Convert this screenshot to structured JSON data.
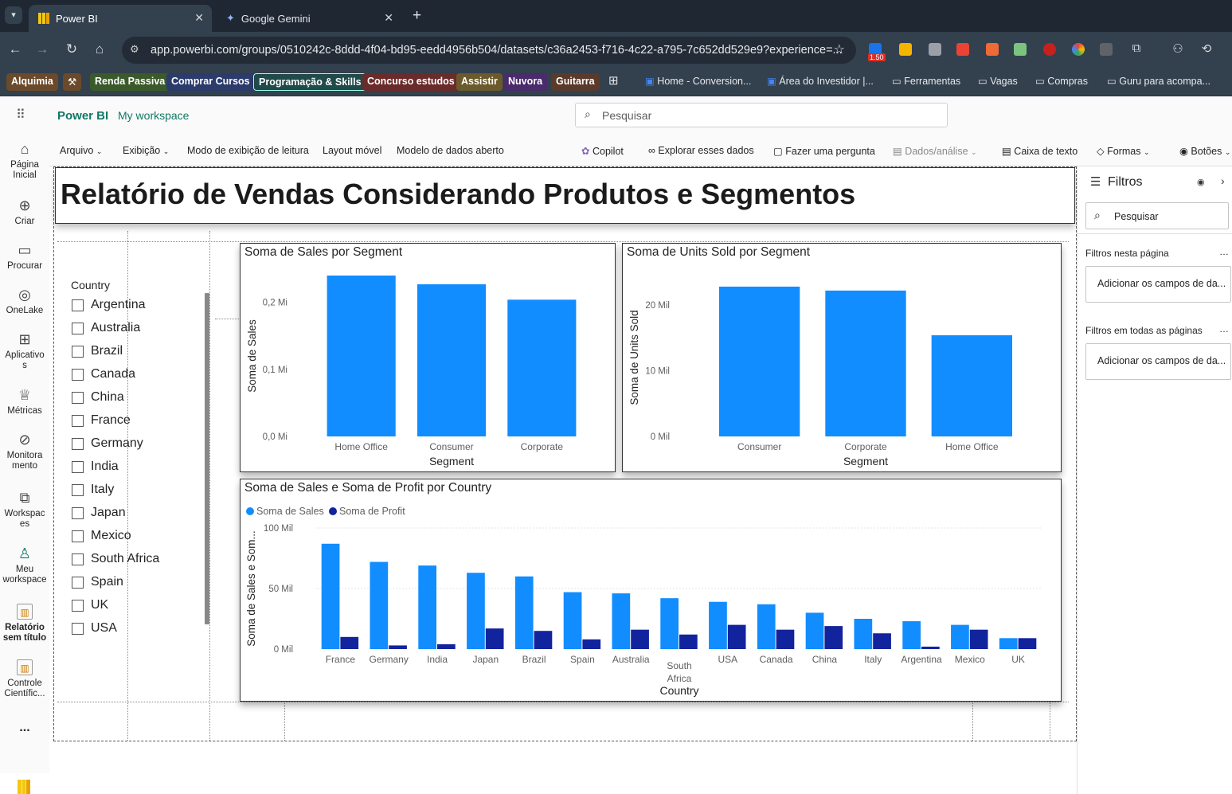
{
  "browser": {
    "tabs": [
      {
        "label": "Power BI"
      },
      {
        "label": "Google Gemini"
      }
    ],
    "url": "app.powerbi.com/groups/0510242c-8ddd-4f04-bd95-eedd4956b504/datasets/c36a2453-f716-4c22-a795-7c652dd529e9?experience=...",
    "ext_badge": "1.50",
    "bookmarks": [
      "Alquimia",
      "Renda Passiva",
      "Comprar Cursos",
      "Programação & Skills",
      "Concurso estudos",
      "Assistir",
      "Nuvora",
      "Guitarra"
    ],
    "bookmark_folders": [
      "Home - Conversion...",
      "Área do Investidor |...",
      "Ferramentas",
      "Vagas",
      "Compras",
      "Guru para acompa..."
    ]
  },
  "header": {
    "brand": "Power BI",
    "workspace": "My workspace",
    "search_placeholder": "Pesquisar"
  },
  "ribbon": {
    "arquivo": "Arquivo",
    "exibicao": "Exibição",
    "leitura": "Modo de exibição de leitura",
    "layout": "Layout móvel",
    "modelo": "Modelo de dados aberto",
    "copilot": "Copilot",
    "explorar": "Explorar esses dados",
    "pergunta": "Fazer uma pergunta",
    "dados": "Dados/análise",
    "caixa": "Caixa de texto",
    "formas": "Formas",
    "botoes": "Botões"
  },
  "leftnav": {
    "home": [
      "Página",
      "Inicial"
    ],
    "criar": "Criar",
    "procurar": "Procurar",
    "onelake": "OneLake",
    "aplicativos": [
      "Aplicativo",
      "s"
    ],
    "metricas": "Métricas",
    "monitoramento": [
      "Monitora",
      "mento"
    ],
    "workspaces": [
      "Workspac",
      "es"
    ],
    "meu": [
      "Meu",
      "workspace"
    ],
    "relatorio": [
      "Relatório",
      "sem título"
    ],
    "controle": [
      "Controle",
      "Científic..."
    ],
    "more": "..."
  },
  "report": {
    "title": "Relatório de Vendas Considerando Produtos e Segmentos"
  },
  "slicer": {
    "header": "Country",
    "items": [
      "Argentina",
      "Australia",
      "Brazil",
      "Canada",
      "China",
      "France",
      "Germany",
      "India",
      "Italy",
      "Japan",
      "Mexico",
      "South Africa",
      "Spain",
      "UK",
      "USA"
    ]
  },
  "filters": {
    "title": "Filtros",
    "search_placeholder": "Pesquisar",
    "this_page": "Filtros nesta página",
    "this_page_card": "Adicionar os campos de da...",
    "all_pages": "Filtros em todas as páginas",
    "all_pages_card": "Adicionar os campos de da..."
  },
  "chart_data": [
    {
      "type": "bar",
      "title": "Soma de Sales por Segment",
      "xlabel": "Segment",
      "ylabel": "Soma de Sales",
      "categories": [
        "Home Office",
        "Consumer",
        "Corporate"
      ],
      "values": [
        0.24,
        0.227,
        0.204
      ],
      "ylim": [
        0,
        0.24
      ],
      "yticks": [
        0,
        0.1,
        0.2
      ],
      "ytick_labels": [
        "0,0 Mi",
        "0,1 Mi",
        "0,2 Mi"
      ],
      "color": "#118DFF"
    },
    {
      "type": "bar",
      "title": "Soma de Units Sold por Segment",
      "xlabel": "Segment",
      "ylabel": "Soma de Units Sold",
      "categories": [
        "Consumer",
        "Corporate",
        "Home Office"
      ],
      "values": [
        22.8,
        22.2,
        15.4
      ],
      "ylim": [
        0,
        24
      ],
      "yticks": [
        0,
        10,
        20
      ],
      "ytick_labels": [
        "0 Mil",
        "10 Mil",
        "20 Mil"
      ],
      "color": "#118DFF"
    },
    {
      "type": "bar",
      "title": "Soma de Sales e Soma de Profit por Country",
      "xlabel": "Country",
      "ylabel": "Soma de Sales e Som...",
      "categories": [
        "France",
        "Germany",
        "India",
        "Japan",
        "Brazil",
        "Spain",
        "Australia",
        "South Africa",
        "USA",
        "Canada",
        "China",
        "Italy",
        "Argentina",
        "Mexico",
        "UK"
      ],
      "series": [
        {
          "name": "Soma de Sales",
          "color": "#118DFF",
          "values": [
            87,
            72,
            69,
            63,
            60,
            47,
            46,
            42,
            39,
            37,
            30,
            25,
            23,
            20,
            9
          ]
        },
        {
          "name": "Soma de Profit",
          "color": "#12239E",
          "values": [
            10,
            3,
            4,
            17,
            15,
            8,
            16,
            12,
            20,
            16,
            19,
            13,
            2,
            16,
            9
          ]
        }
      ],
      "ylim": [
        0,
        100
      ],
      "yticks": [
        0,
        50,
        100
      ],
      "ytick_labels": [
        "0 Mil",
        "50 Mil",
        "100 Mil"
      ],
      "legend": "top-left"
    }
  ]
}
